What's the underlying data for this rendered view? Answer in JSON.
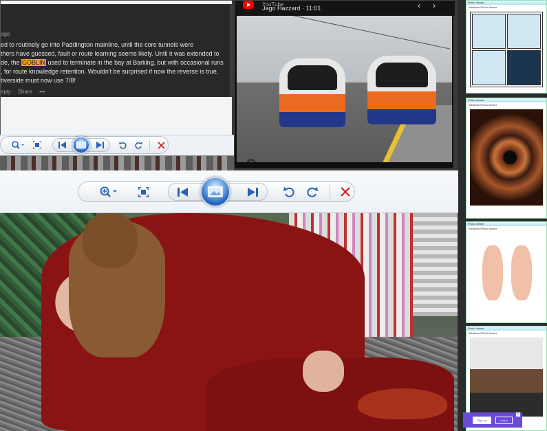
{
  "comment": {
    "ago": "ago",
    "lines": [
      "ed to routinely go into Paddington mainline, until the core tunnels were",
      "thers have guessed, fault or route learning seems likely. Until it was extended to",
      "de, the ",
      "GOBLIN",
      " used to terminate in the bay at Barking, but with occasional runs",
      ", for route knowledge retention. Wouldn't be surprised if now the reverse is true,",
      "tiverside must now use 7/8!"
    ],
    "reply": "eply",
    "share": "Share",
    "more": "•••"
  },
  "youtube": {
    "title": "YouTube",
    "author": "Jago Hazzard",
    "time": "11:01",
    "prev": "‹",
    "next": "›",
    "camera_icon": "camera-icon"
  },
  "thumbs": [
    {
      "header": "Photo Viewer",
      "caption": "Windows Photo Viewer"
    },
    {
      "header": "Photo Viewer",
      "caption": "Windows Photo Viewer"
    },
    {
      "header": "Photo Viewer",
      "caption": "Windows Photo Viewer"
    },
    {
      "header": "Photo Viewer",
      "caption": "Windows Photo Viewer"
    }
  ],
  "promo": {
    "signup": "Sign up",
    "login": "Log in",
    "close": "×"
  },
  "toolbar": {
    "zoom_icon": "zoom-icon",
    "actual_size_icon": "fit-window-icon",
    "previous_icon": "previous-icon",
    "slideshow_icon": "slideshow-icon",
    "next_icon": "next-icon",
    "rotate_left_icon": "rotate-ccw-icon",
    "rotate_right_icon": "rotate-cw-icon",
    "delete_icon": "delete-icon"
  },
  "colors": {
    "accent_blue": "#2b64b5",
    "delete_red": "#c8242b",
    "highlight": "#f2a31b",
    "youtube_red": "#ff0000",
    "promo_purple": "#6c4ad8"
  }
}
